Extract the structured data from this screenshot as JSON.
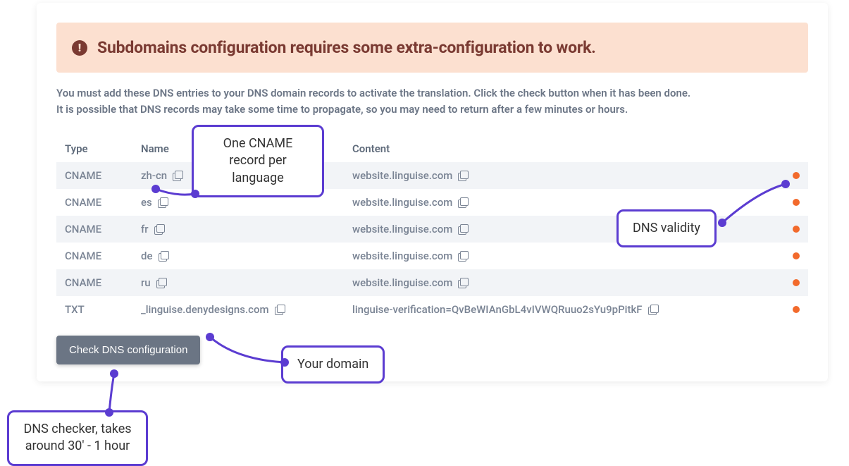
{
  "alert": {
    "text": "Subdomains configuration requires some extra-configuration to work."
  },
  "description": {
    "line1": "You must add these DNS entries to your DNS domain records to activate the translation. Click the check button when it has been done.",
    "line2": "It is possible that DNS records may take some time to propagate, so you may need to return after a few minutes or hours."
  },
  "table": {
    "headers": {
      "type": "Type",
      "name": "Name",
      "content": "Content"
    },
    "rows": [
      {
        "type": "CNAME",
        "name": "zh-cn",
        "content": "website.linguise.com"
      },
      {
        "type": "CNAME",
        "name": "es",
        "content": "website.linguise.com"
      },
      {
        "type": "CNAME",
        "name": "fr",
        "content": "website.linguise.com"
      },
      {
        "type": "CNAME",
        "name": "de",
        "content": "website.linguise.com"
      },
      {
        "type": "CNAME",
        "name": "ru",
        "content": "website.linguise.com"
      },
      {
        "type": "TXT",
        "name": "_linguise.denydesigns.com",
        "content": "linguise-verification=QvBeWIAnGbL4vIVWQRuuo2sYu9pPitkF"
      }
    ]
  },
  "button": {
    "check_label": "Check DNS configuration"
  },
  "annotations": {
    "cname": "One CNAME record per language",
    "validity": "DNS validity",
    "domain": "Your domain",
    "checker": "DNS checker, takes around 30' - 1 hour"
  },
  "colors": {
    "status_pending": "#f26a2c",
    "annotation": "#5b3cd1",
    "alert_bg": "#fce0d0",
    "alert_fg": "#7a3a32"
  }
}
